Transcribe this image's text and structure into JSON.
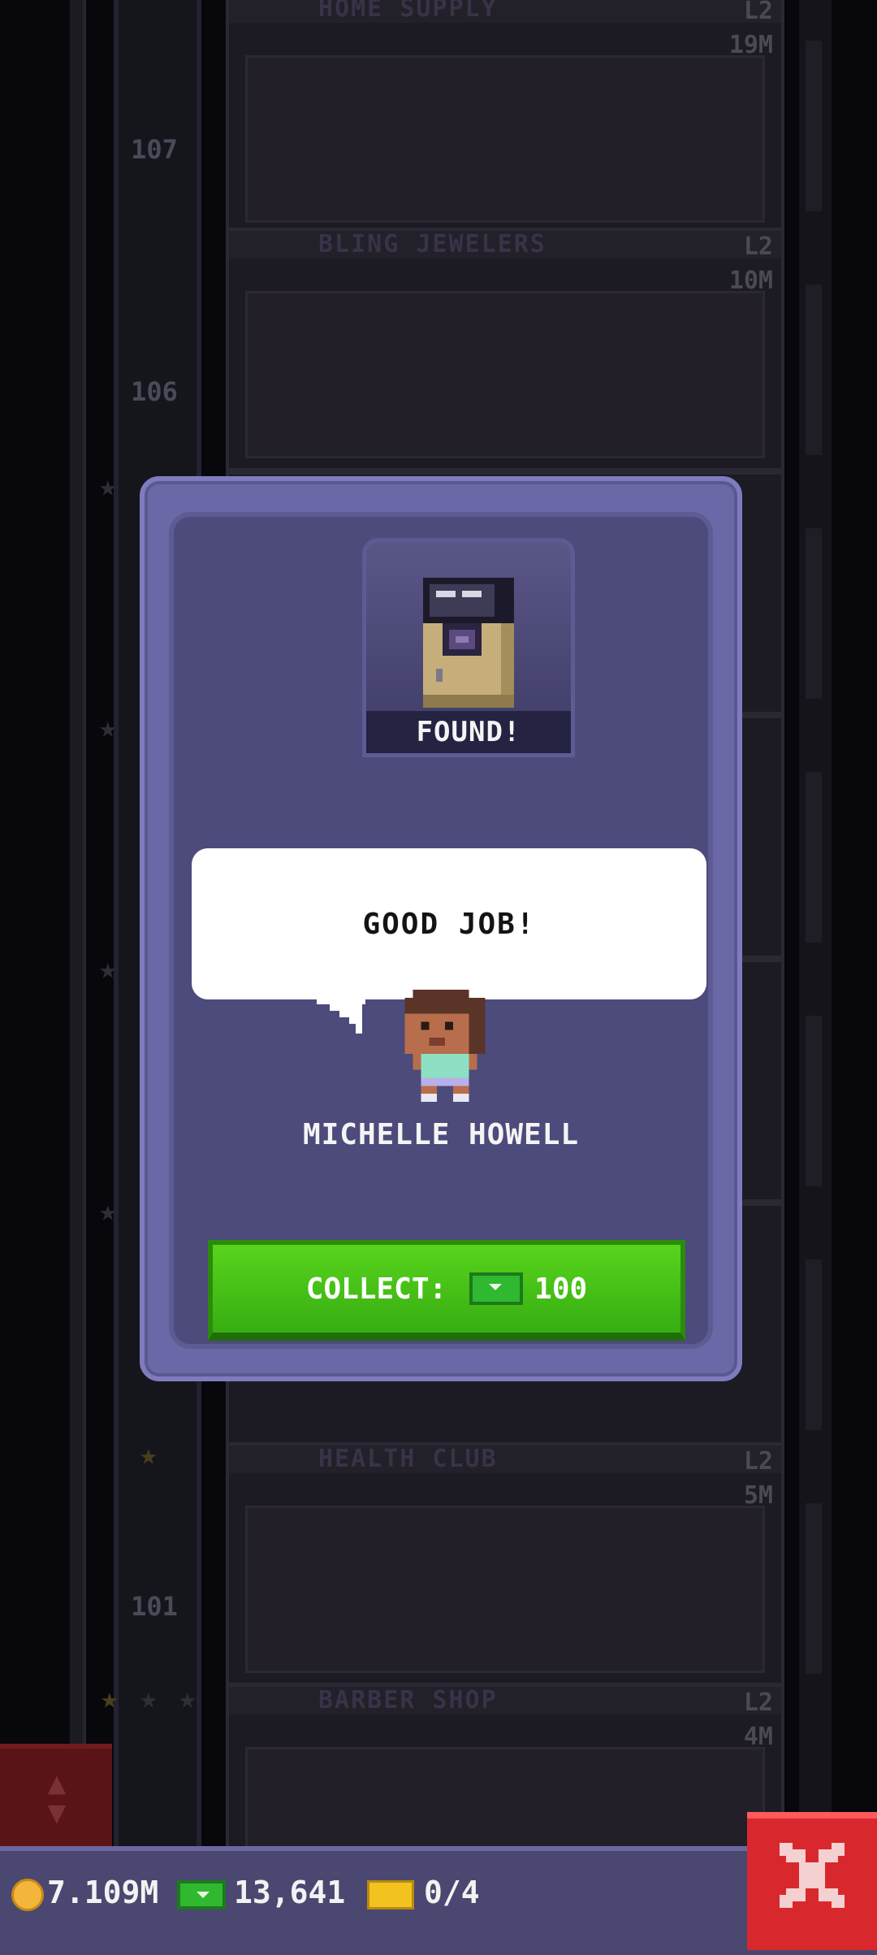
{
  "background": {
    "floor_numbers": [
      "107",
      "106",
      "101"
    ],
    "floors": [
      {
        "name": "HOME SUPPLY",
        "level": "L2",
        "price": "19M"
      },
      {
        "name": "BLING JEWELERS",
        "level": "L2",
        "price": "10M"
      },
      {
        "name": "HEALTH CLUB",
        "level": "L2",
        "price": "5M"
      },
      {
        "name": "BARBER SHOP",
        "level": "L2",
        "price": "4M"
      }
    ]
  },
  "dialog": {
    "item_status": "FOUND!",
    "item_icon": "safe-icon",
    "speech": "GOOD JOB!",
    "npc_name": "MICHELLE HOWELL",
    "collect": {
      "label": "COLLECT:",
      "currency_icon": "bux-icon",
      "amount": "100"
    }
  },
  "hud": {
    "coins": "7.109M",
    "bux": "13,641",
    "tickets": "0/4"
  },
  "colors": {
    "dialog_bg": "#4d4a7c",
    "collect_green": "#45c018",
    "close_red": "#d8282e",
    "hud_bg": "#4a4770"
  }
}
